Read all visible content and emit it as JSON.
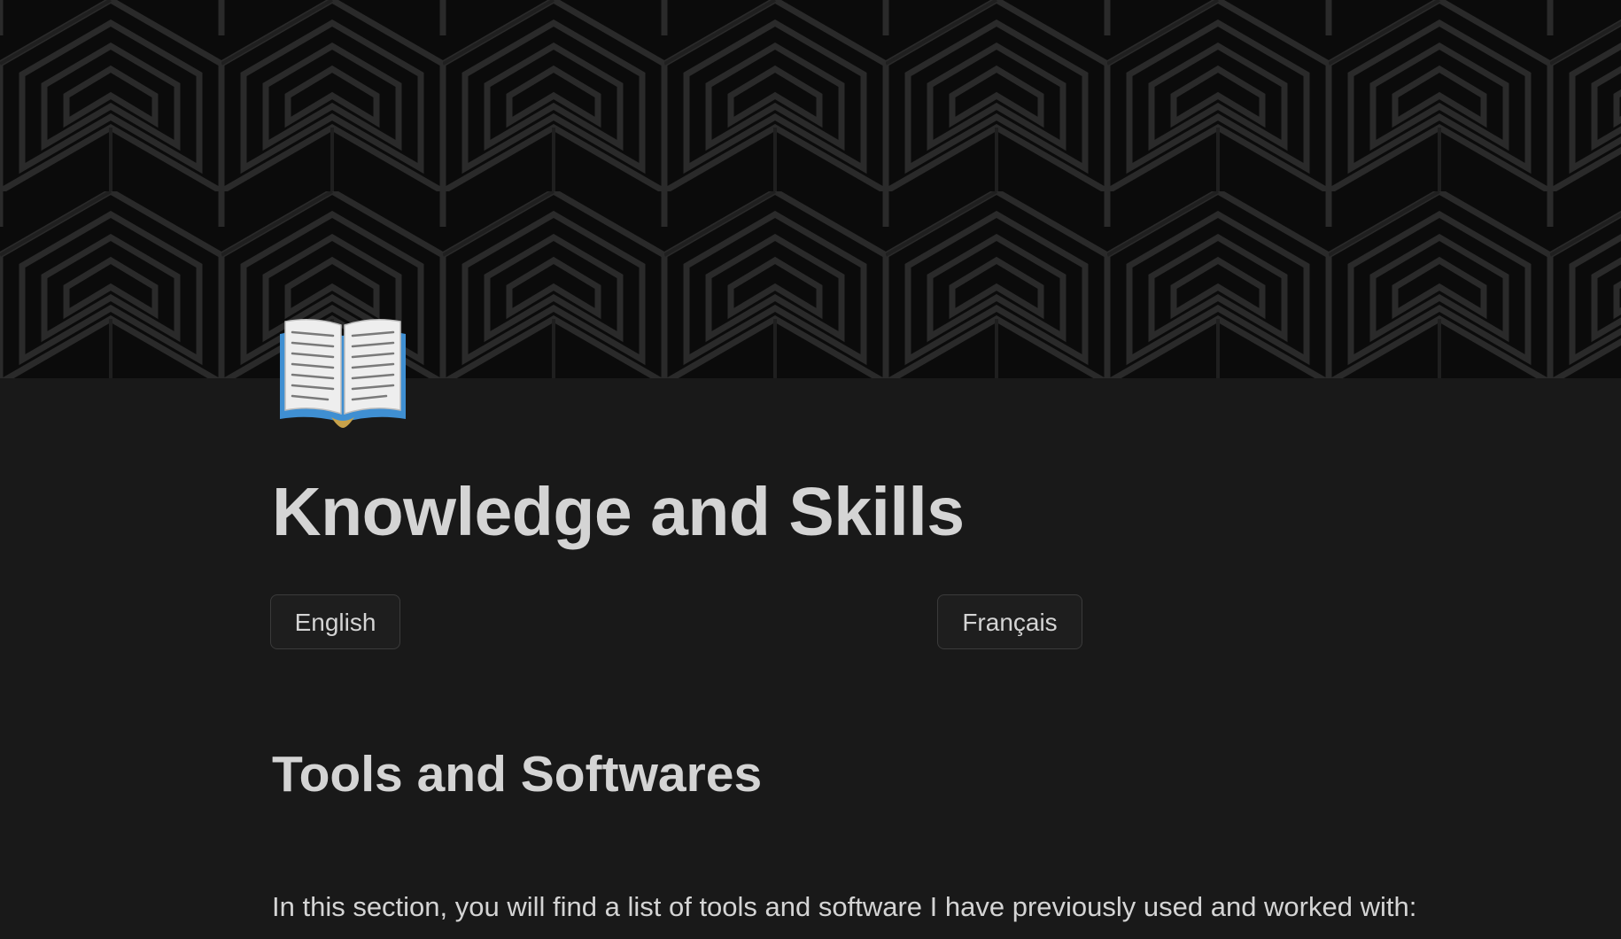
{
  "cover": {
    "pattern": "dark geometric hexagon maze pattern"
  },
  "page": {
    "icon": "open-book-icon",
    "title": "Knowledge and Skills"
  },
  "language_buttons": {
    "english": "English",
    "french": "Français"
  },
  "section": {
    "heading": "Tools and Softwares",
    "intro": "In this section, you will find a list of tools and software I have previously used and worked with:"
  },
  "colors": {
    "background": "#191919",
    "text": "#d4d4d4",
    "button_border": "#3b3b3b",
    "cover": "#0a0a0a"
  }
}
